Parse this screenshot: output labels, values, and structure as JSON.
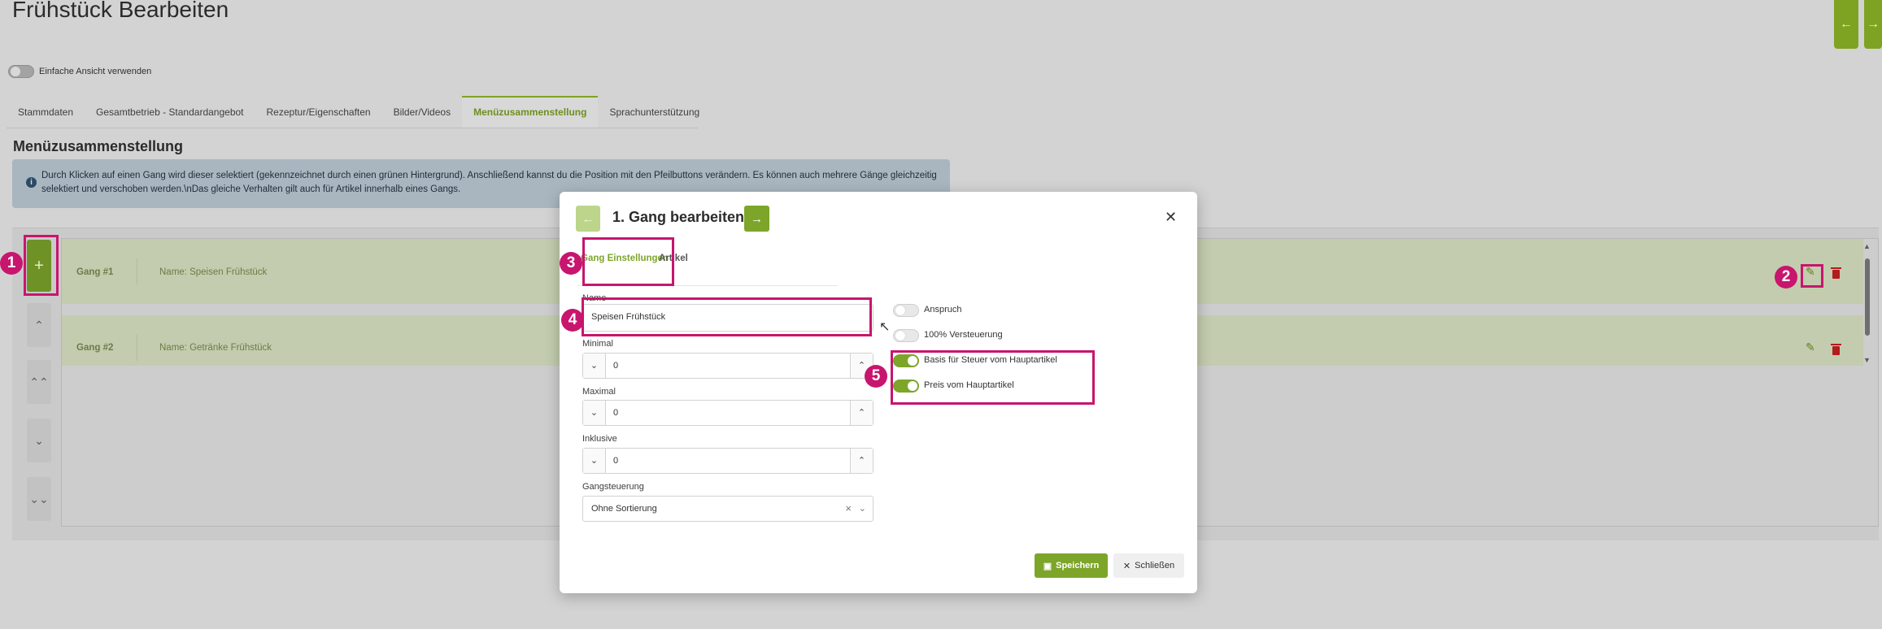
{
  "page": {
    "title": "Frühstück Bearbeiten",
    "simple_view_label": "Einfache Ansicht verwenden",
    "tabs": [
      {
        "label": "Stammdaten"
      },
      {
        "label": "Gesamtbetrieb - Standardangebot"
      },
      {
        "label": "Rezeptur/Eigenschaften"
      },
      {
        "label": "Bilder/Videos"
      },
      {
        "label": "Menüzusammenstellung"
      },
      {
        "label": "Sprachunterstützung"
      }
    ],
    "active_tab": "Menüzusammenstellung",
    "section_title": "Menüzusammenstellung",
    "info_icon": "info-icon",
    "info_text": "Durch Klicken auf einen Gang wird dieser selektiert (gekennzeichnet durch einen grünen Hintergrund). Anschließend kannst du die Position mit den Pfeilbuttons verändern. Es können auch mehrere Gänge gleichzeitig selektiert und verschoben werden.\\nDas gleiche Verhalten gilt auch für Artikel innerhalb eines Gangs.",
    "courses": [
      {
        "label": "Gang #1",
        "name": "Name: Speisen Frühstück"
      },
      {
        "label": "Gang #2",
        "name": "Name: Getränke Frühstück"
      }
    ],
    "side_buttons": [
      "plus-icon",
      "chevron-up-icon",
      "double-chevron-up-icon",
      "chevron-down-icon",
      "double-chevron-down-icon"
    ],
    "accent_color": "#7da529"
  },
  "annotations": [
    "1",
    "2",
    "3",
    "4",
    "5"
  ],
  "modal": {
    "title": "1. Gang bearbeiten",
    "tabs": [
      "Gang Einstellungen",
      "Artikel"
    ],
    "fields": {
      "name_label": "Name",
      "name_value": "Speisen Frühstück",
      "minimal_label": "Minimal",
      "minimal_value": "0",
      "maximal_label": "Maximal",
      "maximal_value": "0",
      "inklusive_label": "Inklusive",
      "inklusive_value": "0",
      "gangsteuerung_label": "Gangsteuerung",
      "gangsteuerung_value": "Ohne Sortierung"
    },
    "switches": [
      {
        "label": "Anspruch",
        "on": false
      },
      {
        "label": "100% Versteuerung",
        "on": false
      },
      {
        "label": "Basis für Steuer vom Hauptartikel",
        "on": true
      },
      {
        "label": "Preis vom Hauptartikel",
        "on": true
      }
    ],
    "save_label": "Speichern",
    "close_label": "Schließen"
  }
}
